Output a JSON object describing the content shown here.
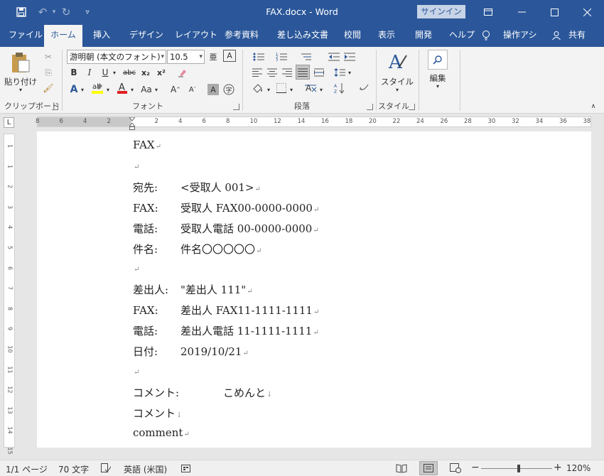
{
  "title_bar": {
    "document_title": "FAX.docx  -  Word",
    "signin_label": "サインイン",
    "qat": {
      "save_icon": "save-icon",
      "undo_icon": "undo-icon",
      "redo_icon": "redo-icon",
      "customize_icon": "chevron-down-icon"
    },
    "window_controls": [
      "ribbon-display-options-icon",
      "minimize-icon",
      "maximize-icon",
      "close-icon"
    ]
  },
  "tabs": [
    {
      "label": "ファイル"
    },
    {
      "label": "ホーム",
      "active": true
    },
    {
      "label": "挿入"
    },
    {
      "label": "デザイン"
    },
    {
      "label": "レイアウト"
    },
    {
      "label": "参考資料"
    },
    {
      "label": "差し込み文書"
    },
    {
      "label": "校閲"
    },
    {
      "label": "表示"
    },
    {
      "label": "開発"
    },
    {
      "label": "ヘルプ"
    },
    {
      "label": "操作アシ"
    },
    {
      "label": "共有"
    }
  ],
  "ribbon": {
    "clipboard": {
      "label": "クリップボード",
      "paste_label": "貼り付け"
    },
    "font": {
      "label": "フォント",
      "font_name": "游明朝 (本文のフォント)",
      "font_size": "10.5",
      "bold": "B",
      "italic": "I",
      "underline": "U",
      "strike": "abc",
      "subscript": "x₂",
      "superscript": "x²",
      "change_case": "Aa"
    },
    "paragraph": {
      "label": "段落"
    },
    "styles": {
      "label": "スタイル",
      "button_label": "スタイル"
    },
    "editing": {
      "button_label": "編集"
    }
  },
  "ruler": {
    "tab_selector": "L",
    "horizontal_numbers": [
      "8",
      "6",
      "4",
      "2",
      "",
      "2",
      "4",
      "6",
      "8",
      "10",
      "12",
      "14",
      "16",
      "18",
      "20",
      "22",
      "24",
      "26",
      "28",
      "30",
      "32",
      "34",
      "36",
      "38"
    ],
    "vertical_numbers": [
      "1",
      "1",
      "2",
      "3",
      "4",
      "5",
      "6",
      "7",
      "8",
      "9",
      "10",
      "11",
      "12",
      "13",
      "14",
      "15"
    ]
  },
  "document": {
    "lines": [
      {
        "text": "FAX",
        "mark": "↵"
      },
      {
        "text": "",
        "mark": "↵"
      },
      {
        "label": "宛先:",
        "value": "<受取人 001>",
        "mark": "↵"
      },
      {
        "label": "FAX:",
        "value": "受取人 FAX00-0000-0000",
        "mark": "↵"
      },
      {
        "label": "電話:",
        "value": "受取人電話 00-0000-0000",
        "mark": "↵"
      },
      {
        "label": "件名:",
        "value": "件名〇〇〇〇〇",
        "mark": "↵"
      },
      {
        "text": "",
        "mark": "↵"
      },
      {
        "label": "差出人:",
        "value": "\"差出人 111\"",
        "mark": "↵"
      },
      {
        "label": "FAX:",
        "value": "差出人 FAX11-1111-1111",
        "mark": "↵"
      },
      {
        "label": "電話:",
        "value": "差出人電話 11-1111-1111",
        "mark": "↵"
      },
      {
        "label": "日付:",
        "value": "2019/10/21",
        "mark": "↵"
      },
      {
        "text": "",
        "mark": "↵"
      },
      {
        "text": "コメント:             こめんと",
        "mark": "↓"
      },
      {
        "text": "コメント",
        "mark": "↓"
      },
      {
        "text": "comment",
        "mark": "↵"
      }
    ]
  },
  "status_bar": {
    "page": "1/1 ページ",
    "word_count": "70 文字",
    "language": "英語 (米国)",
    "zoom": "120%",
    "zoom_minus": "−",
    "zoom_plus": "+"
  }
}
